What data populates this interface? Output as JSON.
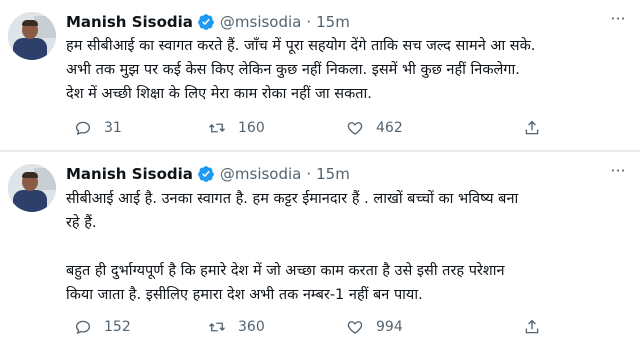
{
  "colors": {
    "text": "#0f1419",
    "secondary": "#536471",
    "verified": "#1d9bf0",
    "divider": "#e6ebee"
  },
  "tweets": [
    {
      "name": "Manish Sisodia",
      "handle": "@msisodia",
      "sep": "·",
      "time": "15m",
      "more": "···",
      "lines": [
        "हम सीबीआई का स्वागत करते हैं. जाँच में पूरा सहयोग देंगे ताकि सच जल्द सामने आ सके.",
        "अभी तक मुझ पर कई केस किए लेकिन कुछ नहीं निकला. इसमें भी कुछ नहीं निकलेगा.",
        "देश में अच्छी शिक्षा के लिए मेरा काम रोका नहीं जा सकता."
      ],
      "replies": "31",
      "retweets": "160",
      "likes": "462",
      "icons": [
        "reply-icon",
        "retweet-icon",
        "like-icon",
        "share-icon"
      ]
    },
    {
      "name": "Manish Sisodia",
      "handle": "@msisodia",
      "sep": "·",
      "time": "15m",
      "more": "···",
      "lines": [
        "सीबीआई आई है. उनका स्वागत है. हम कट्टर ईमानदार हैं . लाखों बच्चों का भविष्य बना",
        "रहे हैं.",
        "",
        "बहुत ही दुर्भाग्यपूर्ण है कि हमारे देश में जो अच्छा काम करता है उसे इसी तरह परेशान",
        "किया जाता है. इसीलिए हमारा देश अभी तक नम्बर-1 नहीं बन पाया."
      ],
      "replies": "152",
      "retweets": "360",
      "likes": "994",
      "icons": [
        "reply-icon",
        "retweet-icon",
        "like-icon",
        "share-icon"
      ]
    }
  ]
}
